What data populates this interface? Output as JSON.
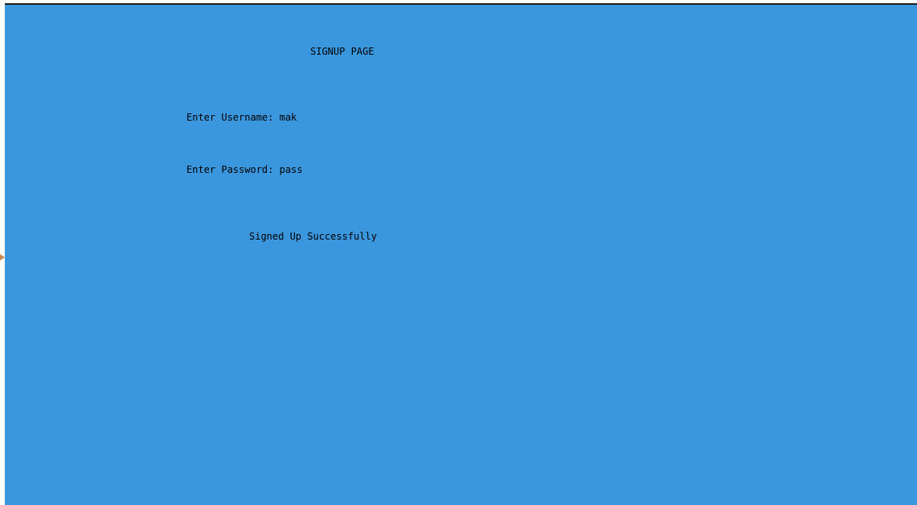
{
  "console": {
    "background_color": "#3a96dd",
    "text_color": "#000000"
  },
  "signup": {
    "title": "SIGNUP PAGE",
    "username_prompt": "Enter Username: ",
    "username_value": "mak",
    "password_prompt": "Enter Password: ",
    "password_value": "pass",
    "status_message": "Signed Up Successfully"
  }
}
